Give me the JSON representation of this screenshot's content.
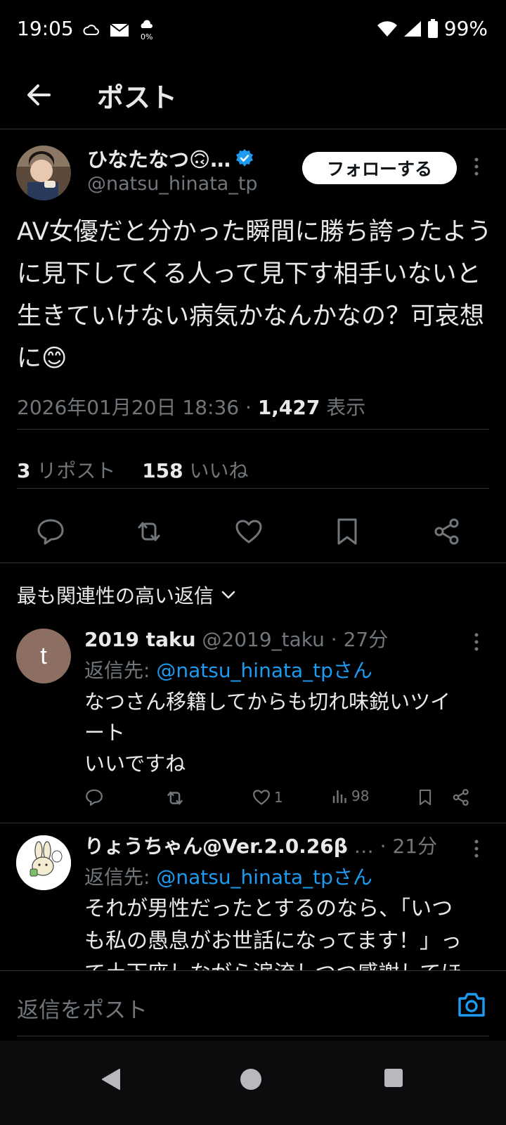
{
  "status": {
    "time": "19:05",
    "battery": "99%",
    "icons": [
      "cloud-icon",
      "mail-icon",
      "rain-percent-icon",
      "wifi-icon",
      "signal-icon",
      "battery-icon"
    ]
  },
  "header": {
    "title": "ポスト"
  },
  "post": {
    "author_name": "ひなたなつ🙃…",
    "author_handle": "@natsu_hinata_tp",
    "follow_label": "フォローする",
    "text": "AV女優だと分かった瞬間に勝ち誇ったように見下してくる人って見下す相手いないと生きていけない病気かなんかなの？可哀想に😊",
    "date": "2026年01月20日 18:36 · ",
    "views": "1,427",
    "views_label": " 表示",
    "reposts": "3",
    "reposts_label": " リポスト",
    "likes": "158",
    "likes_label": " いいね"
  },
  "replies_section": {
    "sort_label": "最も関連性の高い返信"
  },
  "replies": [
    {
      "avatar_letter": "t",
      "name": "2019 taku",
      "handle": " @2019_taku · 27分",
      "reply_to_prefix": "返信先: ",
      "reply_to_mention": "@natsu_hinata_tpさん",
      "body_line1": "なつさん移籍してからも切れ味鋭いツイ",
      "body_line2": "ート",
      "body_line3": "いいですね",
      "like_count": "1",
      "view_count": "98"
    },
    {
      "name": "りょうちゃん@Ver.2.0.26β",
      "handle": " …  · 21分",
      "reply_to_prefix": "返信先: ",
      "reply_to_mention": "@natsu_hinata_tpさん",
      "body_line1": "それが男性だったとするのなら、「いつ",
      "body_line2": "も私の愚息がお世話になってます！」っ",
      "body_line3": "て土下座しながら涙流しつつ感謝してほ"
    }
  ],
  "compose": {
    "placeholder": "返信をポスト"
  },
  "colors": {
    "background": "#000000",
    "text": "#e7e9ea",
    "muted": "#71767b",
    "accent": "#1d9bf0",
    "divider": "#2f3336"
  }
}
